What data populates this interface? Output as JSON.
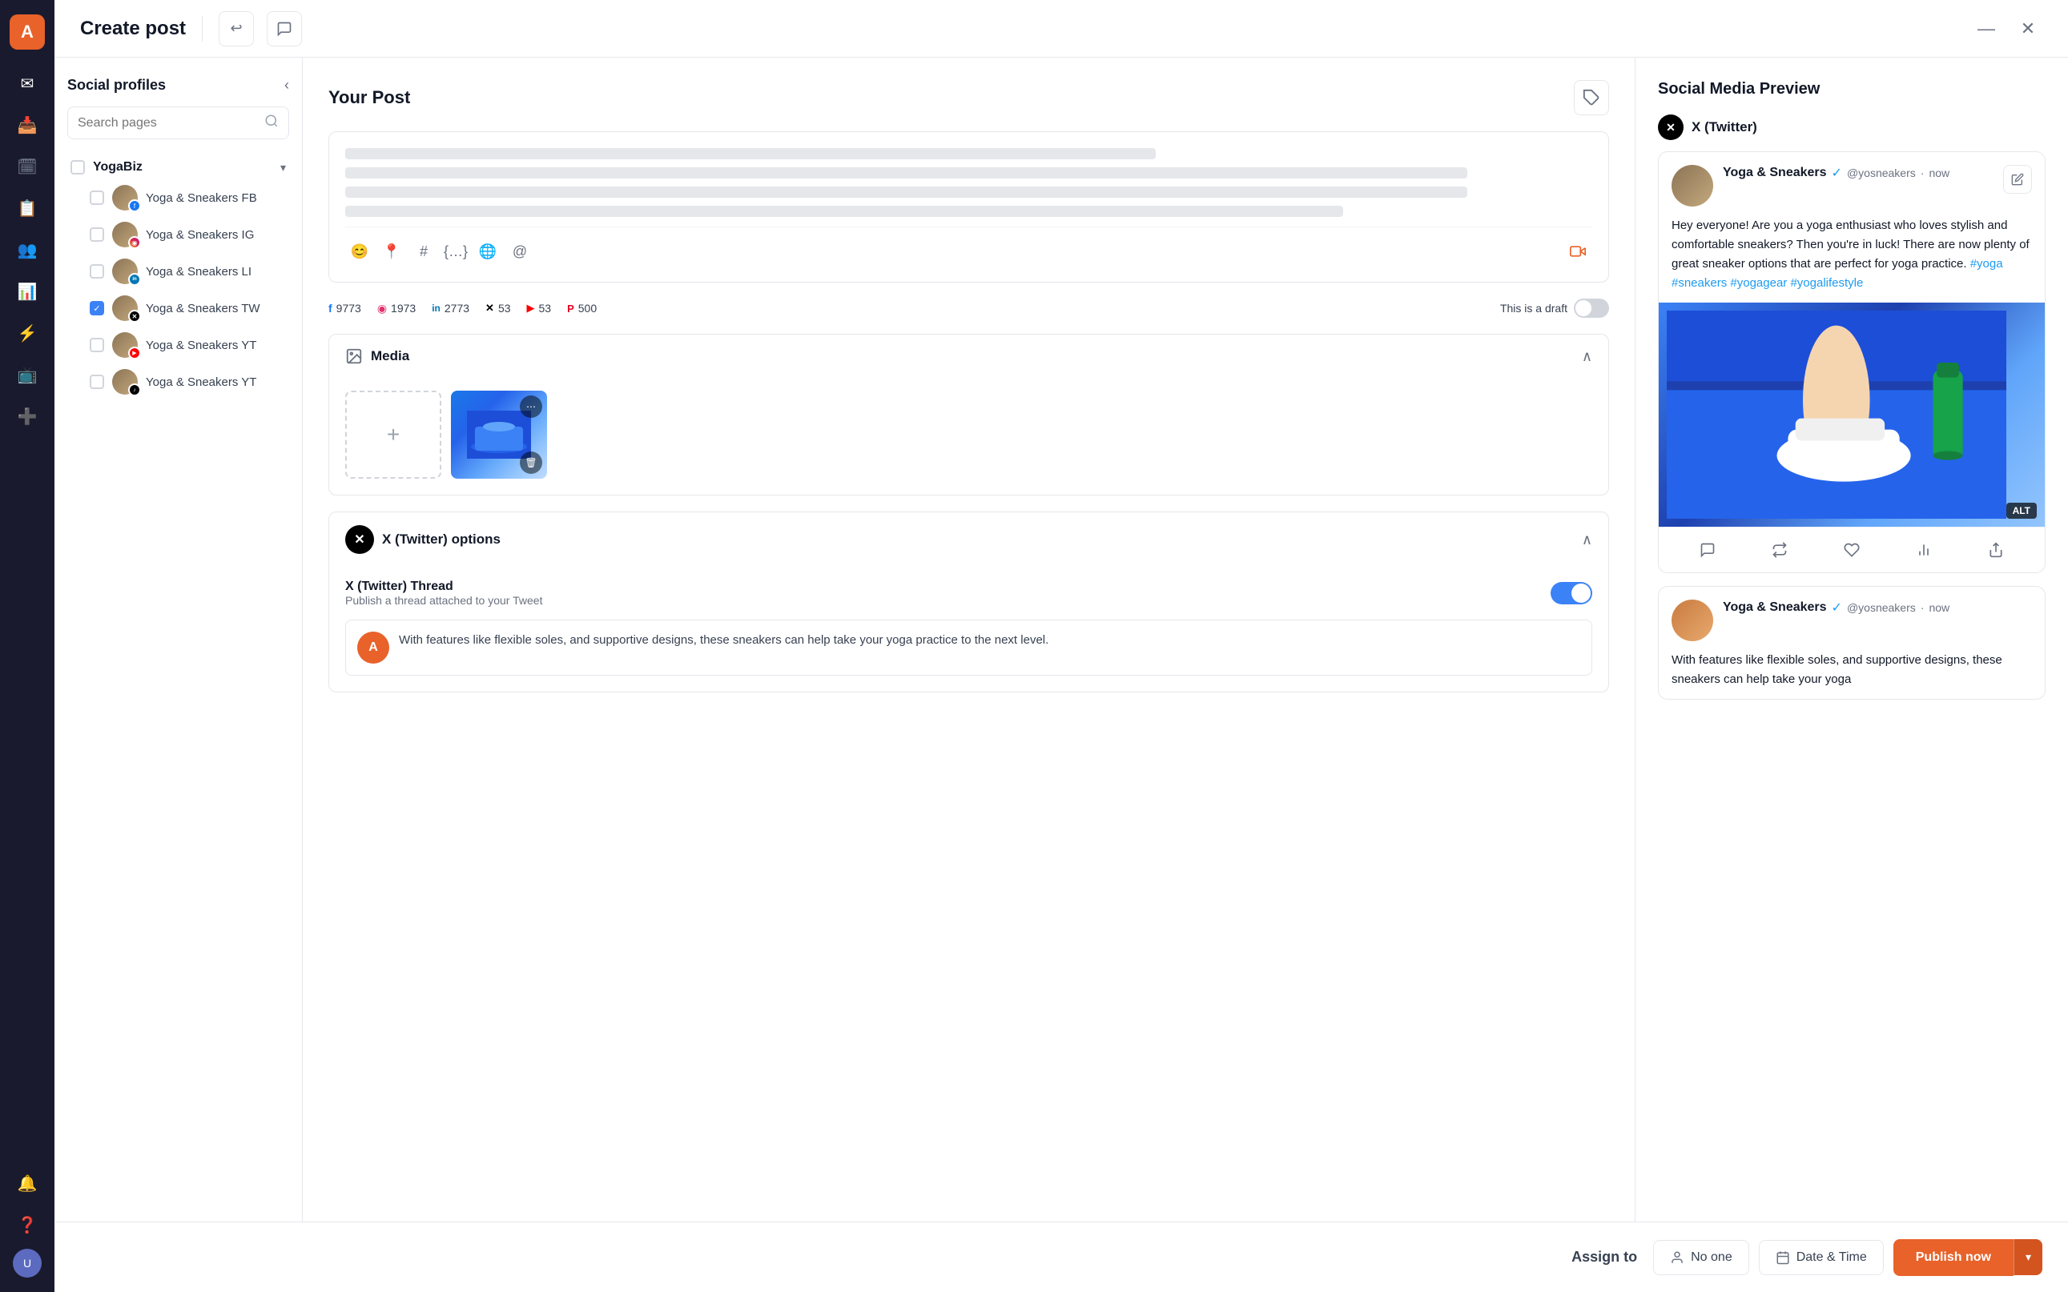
{
  "app": {
    "logo": "A",
    "nav_items": [
      "✉",
      "📱",
      "🗓",
      "📋",
      "👥",
      "📊",
      "⚡",
      "📺",
      "➕"
    ],
    "nav_bottom": [
      "🔔",
      "❓"
    ]
  },
  "modal": {
    "title": "Create post",
    "minimize_icon": "—",
    "close_icon": "✕",
    "history_icon": "↩",
    "thread_icon": "💬"
  },
  "profiles": {
    "section_title": "Social profiles",
    "search_placeholder": "Search pages",
    "collapse_icon": "‹",
    "brand": {
      "name": "YogaBiz",
      "chevron": "▾"
    },
    "items": [
      {
        "name": "Yoga & Sneakers FB",
        "platform": "fb",
        "checked": false
      },
      {
        "name": "Yoga & Sneakers IG",
        "platform": "ig",
        "checked": false
      },
      {
        "name": "Yoga & Sneakers LI",
        "platform": "li",
        "checked": false
      },
      {
        "name": "Yoga & Sneakers TW",
        "platform": "tw",
        "checked": true
      },
      {
        "name": "Yoga & Sneakers YT",
        "platform": "yt",
        "checked": false
      },
      {
        "name": "Yoga & Sneakers YT",
        "platform": "tk",
        "checked": false
      }
    ]
  },
  "post": {
    "section_title": "Your Post",
    "tag_icon": "🏷",
    "is_draft": true,
    "draft_label": "This is a draft",
    "stats": [
      {
        "platform": "fb",
        "icon": "f",
        "count": "9773",
        "color": "#1877f2"
      },
      {
        "platform": "ig",
        "icon": "◉",
        "count": "1973",
        "color": "#e1306c"
      },
      {
        "platform": "li",
        "icon": "in",
        "count": "2773",
        "color": "#0077b5"
      },
      {
        "platform": "tw",
        "icon": "✕",
        "count": "53",
        "color": "#000000"
      },
      {
        "platform": "yt",
        "icon": "▶",
        "count": "53",
        "color": "#ff0000"
      },
      {
        "platform": "pi",
        "icon": "P",
        "count": "500",
        "color": "#e60023"
      }
    ],
    "media_title": "Media",
    "twitter_options_title": "X (Twitter) options",
    "thread": {
      "title": "X (Twitter) Thread",
      "description": "Publish a thread attached to your Tweet",
      "enabled": true,
      "content": "With features like flexible soles, and supportive designs, these sneakers can help take your yoga practice to the next level."
    }
  },
  "preview": {
    "section_title": "Social Media Preview",
    "platform": "X (Twitter)",
    "tweet1": {
      "name": "Yoga & Sneakers",
      "handle": "@yosneakers",
      "time": "now",
      "text": "Hey everyone! Are you a yoga enthusiast who loves stylish and comfortable sneakers? Then you're in luck! There are now plenty of great sneaker options that are perfect for yoga practice. #yoga #sneakers #yogagear #yogalifestyle",
      "has_image": true,
      "alt_text": "ALT"
    },
    "tweet2": {
      "name": "Yoga & Sneakers",
      "handle": "@yosneakers",
      "time": "now",
      "text": "With features like flexible soles, and supportive designs, these sneakers can help take your yoga"
    }
  },
  "footer": {
    "assign_label": "Assign to",
    "no_one_label": "No one",
    "date_label": "Date & Time",
    "publish_label": "Publish now",
    "dropdown_icon": "▾"
  }
}
